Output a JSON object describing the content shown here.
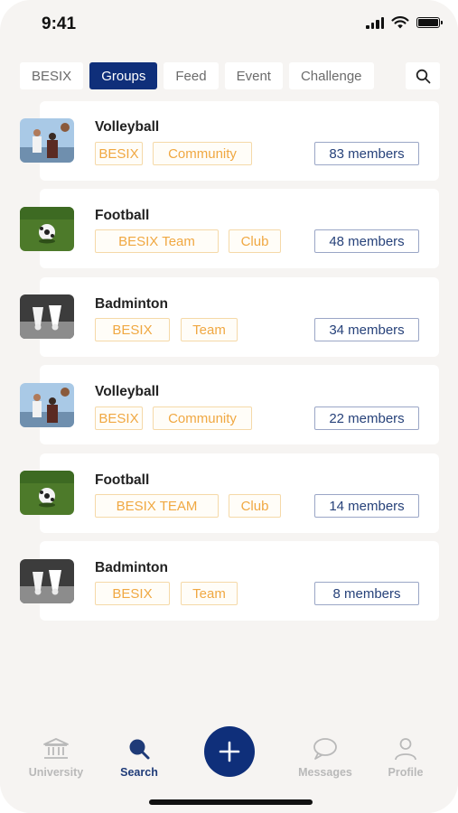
{
  "status_bar": {
    "time": "9:41"
  },
  "tabs": [
    {
      "label": "BESIX",
      "active": false
    },
    {
      "label": "Groups",
      "active": true
    },
    {
      "label": "Feed",
      "active": false
    },
    {
      "label": "Event",
      "active": false
    },
    {
      "label": "Challenge",
      "active": false
    }
  ],
  "groups": [
    {
      "name": "Volleyball",
      "image": "volleyball-photo",
      "tags": [
        "BESIX",
        "Community"
      ],
      "members": "83 members"
    },
    {
      "name": "Football",
      "image": "football-photo",
      "tags": [
        "BESIX Team",
        "Club"
      ],
      "members": "48 members"
    },
    {
      "name": "Badminton",
      "image": "badminton-photo",
      "tags": [
        "BESIX",
        "Team"
      ],
      "members": "34 members"
    },
    {
      "name": "Volleyball",
      "image": "volleyball-photo",
      "tags": [
        "BESIX",
        "Community"
      ],
      "members": "22 members"
    },
    {
      "name": "Football",
      "image": "football-photo",
      "tags": [
        "BESIX TEAM",
        "Club"
      ],
      "members": "14 members"
    },
    {
      "name": "Badminton",
      "image": "badminton-photo",
      "tags": [
        "BESIX",
        "Team"
      ],
      "members": "8 members"
    }
  ],
  "bottom_nav": [
    {
      "label": "University",
      "icon": "university-icon",
      "active": false
    },
    {
      "label": "Search",
      "icon": "search-icon",
      "active": true
    },
    {
      "label": "",
      "icon": "plus-icon",
      "active": false
    },
    {
      "label": "Messages",
      "icon": "chat-bubble-icon",
      "active": false
    },
    {
      "label": "Profile",
      "icon": "person-icon",
      "active": false
    }
  ],
  "colors": {
    "primary": "#0f2f7a",
    "tag_border": "#f5d9a8",
    "tag_text": "#f0a842",
    "members_text": "#27427a",
    "background": "#f6f4f2"
  }
}
